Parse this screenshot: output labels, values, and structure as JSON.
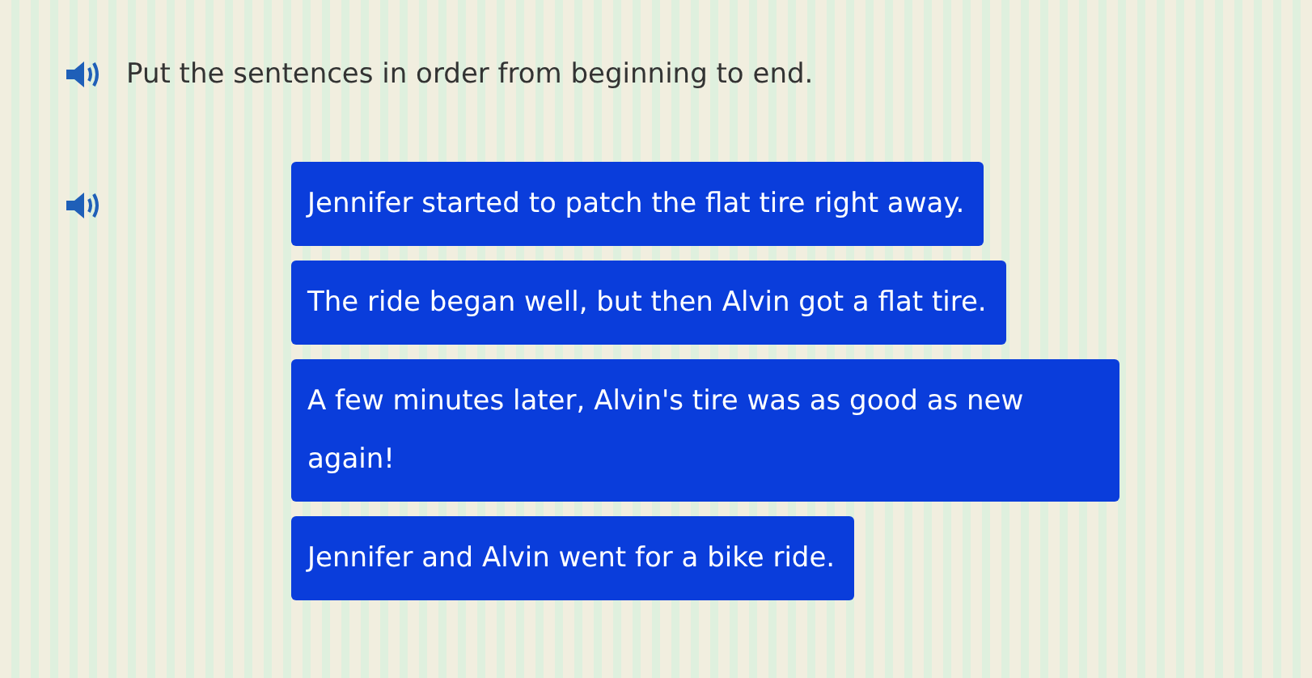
{
  "instruction": {
    "text": "Put the sentences in order from beginning to end.",
    "has_audio": true
  },
  "sentences": [
    {
      "text": "Jennifer started to patch the flat tire right away.",
      "has_audio": true
    },
    {
      "text": "The ride began well, but then Alvin got a flat tire.",
      "has_audio": false
    },
    {
      "text": "A few minutes later, Alvin's tire was as good as new again!",
      "has_audio": false
    },
    {
      "text": "Jennifer and Alvin went for a bike ride.",
      "has_audio": false
    }
  ]
}
